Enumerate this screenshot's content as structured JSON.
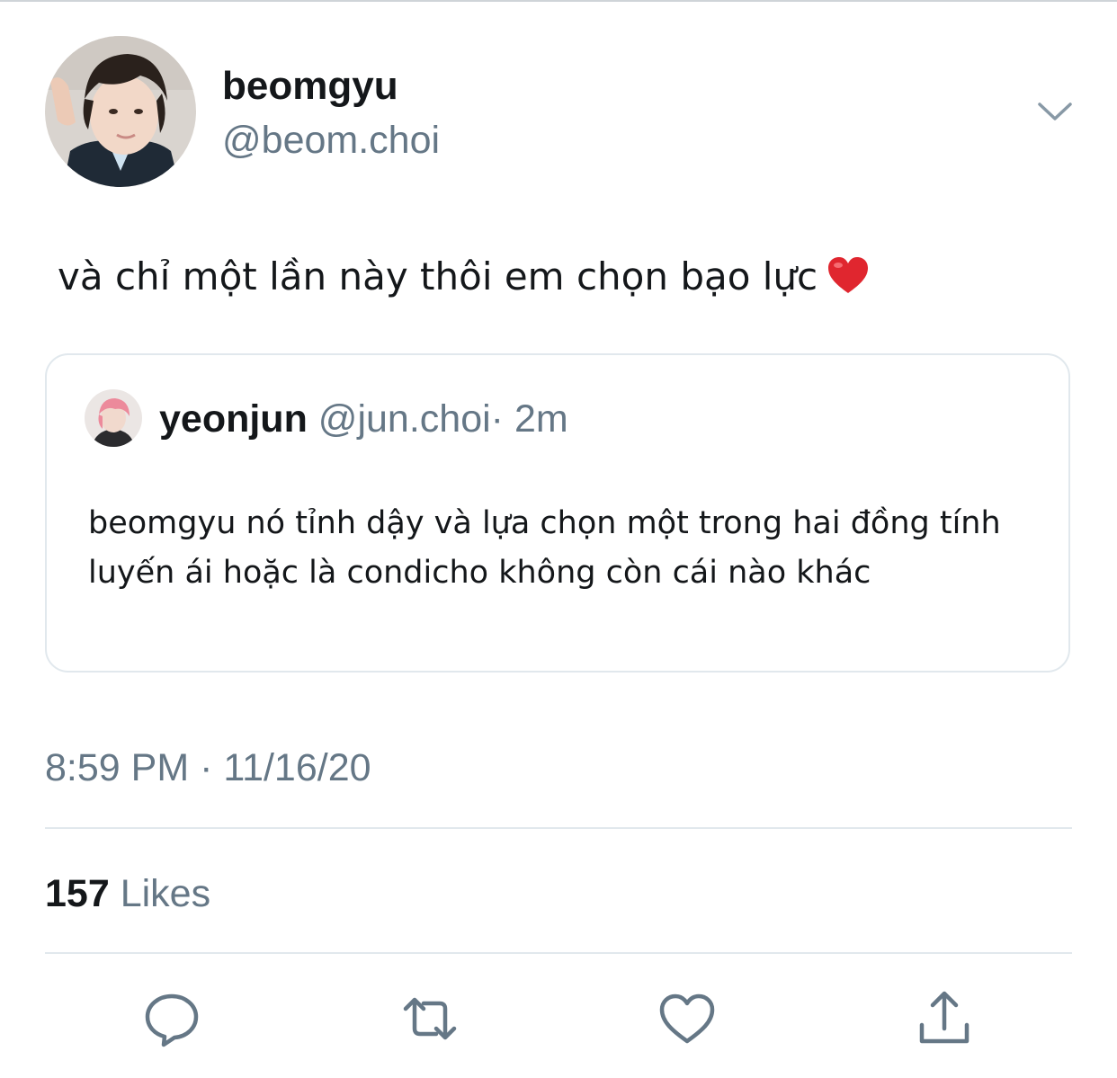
{
  "tweet": {
    "display_name": "beomgyu",
    "handle": "@beom.choi",
    "text": "và chỉ một lần này thôi em chọn bạo lực",
    "emoji": "red-heart-emoji",
    "timestamp": "8:59 PM · 11/16/20"
  },
  "quoted_tweet": {
    "display_name": "yeonjun",
    "handle": "@jun.choi",
    "time": "· 2m",
    "text": "beomgyu nó tỉnh dậy và lựa chọn một trong hai đồng tính luyến ái hoặc là condicho không còn cái nào khác"
  },
  "stats": {
    "likes_count": "157",
    "likes_label": "Likes"
  },
  "actions": [
    "reply-icon",
    "retweet-icon",
    "like-icon",
    "share-icon"
  ],
  "colors": {
    "text_primary": "#14171a",
    "text_secondary": "#657786",
    "border": "#e1e8ed",
    "heart_red": "#e0262f"
  }
}
